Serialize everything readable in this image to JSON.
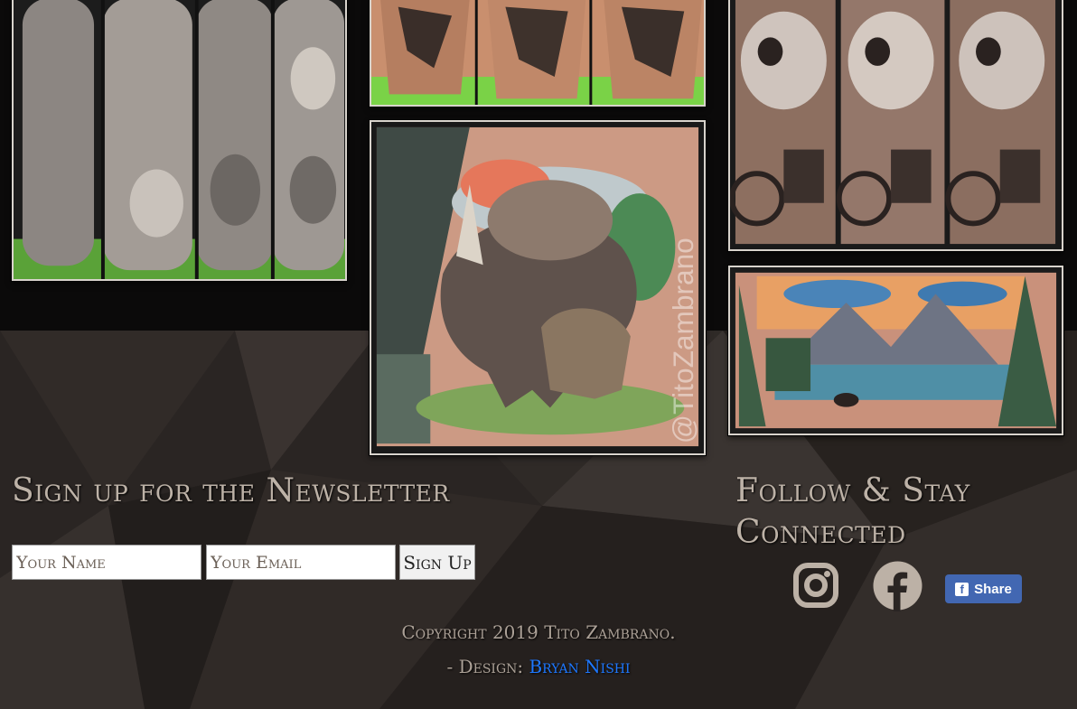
{
  "gallery": {
    "image_1_alt": "Horror portrait sleeve tattoo",
    "image_2_alt": "Black and grey tattoo",
    "image_3_alt": "Skull and motorcycle tattoo",
    "image_4_alt": "Triceratops color tattoo",
    "image_5_alt": "Mountain lake landscape chest tattoo",
    "watermark": "@TitoZambrano"
  },
  "newsletter": {
    "title": "Sign up for the Newsletter",
    "name_placeholder": "Your Name",
    "email_placeholder": "Your Email",
    "submit_label": "Sign Up"
  },
  "social": {
    "title_line1": "Follow & Stay",
    "title_line2": "Connected",
    "instagram_icon": "instagram-icon",
    "facebook_icon": "facebook-icon",
    "share_label": "Share"
  },
  "footer": {
    "copyright": "Copyright 2019 Tito Zambrano.",
    "design_prefix": "- Design:",
    "designer_name": "Bryan Nishi"
  },
  "colors": {
    "background": "#2a2523",
    "heading": "#bdb2a7",
    "link": "#1e78ff",
    "facebook_blue": "#4267b2"
  }
}
